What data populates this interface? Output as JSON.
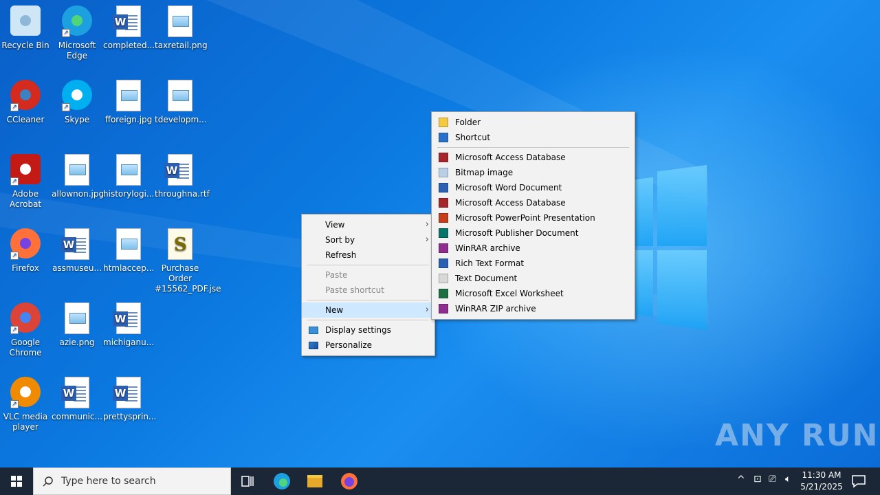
{
  "desktop_icons": [
    {
      "label": "Recycle Bin",
      "icon": "recycle-bin-icon"
    },
    {
      "label": "Microsoft Edge",
      "icon": "edge-icon"
    },
    {
      "label": "completed...",
      "icon": "word-doc-icon"
    },
    {
      "label": "taxretail.png",
      "icon": "image-file-icon"
    },
    {
      "label": "CCleaner",
      "icon": "ccleaner-icon"
    },
    {
      "label": "Skype",
      "icon": "skype-icon"
    },
    {
      "label": "fforeign.jpg",
      "icon": "image-file-icon"
    },
    {
      "label": "tdevelopm...",
      "icon": "image-file-icon"
    },
    {
      "label": "Adobe Acrobat",
      "icon": "acrobat-icon"
    },
    {
      "label": "allownon.jpg",
      "icon": "image-file-icon"
    },
    {
      "label": "historylogi...",
      "icon": "image-file-icon"
    },
    {
      "label": "throughna.rtf",
      "icon": "word-doc-icon"
    },
    {
      "label": "Firefox",
      "icon": "firefox-icon"
    },
    {
      "label": "assmuseu...",
      "icon": "word-doc-icon"
    },
    {
      "label": "htmlaccep...",
      "icon": "image-file-icon"
    },
    {
      "label": "Purchase Order #15562_PDF.jse",
      "icon": "script-file-icon"
    },
    {
      "label": "Google Chrome",
      "icon": "chrome-icon"
    },
    {
      "label": "azie.png",
      "icon": "image-file-icon"
    },
    {
      "label": "michiganu...",
      "icon": "word-doc-icon"
    },
    {
      "label": "VLC media player",
      "icon": "vlc-icon"
    },
    {
      "label": "communic...",
      "icon": "word-doc-icon"
    },
    {
      "label": "prettysprin...",
      "icon": "word-doc-icon"
    }
  ],
  "context_menu": {
    "view": "View",
    "sort_by": "Sort by",
    "refresh": "Refresh",
    "paste": "Paste",
    "paste_shortcut": "Paste shortcut",
    "new": "New",
    "display_settings": "Display settings",
    "personalize": "Personalize"
  },
  "new_submenu": {
    "items": [
      {
        "label": "Folder",
        "color": "#f5c842"
      },
      {
        "label": "Shortcut",
        "color": "#2a6fc9"
      },
      {
        "label": "Microsoft Access Database",
        "color": "#a4262c"
      },
      {
        "label": "Bitmap image",
        "color": "#b8cfe6"
      },
      {
        "label": "Microsoft Word Document",
        "color": "#2b5fb4"
      },
      {
        "label": "Microsoft Access Database",
        "color": "#a4262c"
      },
      {
        "label": "Microsoft PowerPoint Presentation",
        "color": "#c43e1c"
      },
      {
        "label": "Microsoft Publisher Document",
        "color": "#077568"
      },
      {
        "label": "WinRAR archive",
        "color": "#8e2d8e"
      },
      {
        "label": "Rich Text Format",
        "color": "#2b5fb4"
      },
      {
        "label": "Text Document",
        "color": "#d8d8d8"
      },
      {
        "label": "Microsoft Excel Worksheet",
        "color": "#1d6f42"
      },
      {
        "label": "WinRAR ZIP archive",
        "color": "#8e2d8e"
      }
    ]
  },
  "taskbar": {
    "search_placeholder": "Type here to search",
    "time": "11:30 AM",
    "date": "5/21/2025"
  },
  "watermark": "ANY RUN"
}
